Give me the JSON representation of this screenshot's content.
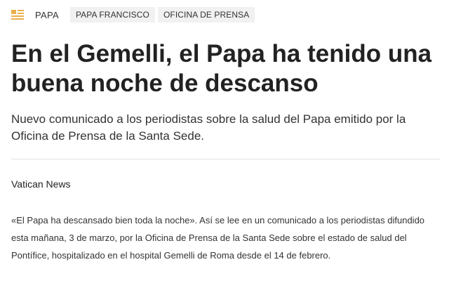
{
  "header": {
    "icon": "news-icon",
    "section": "PAPA",
    "tags": [
      "PAPA FRANCISCO",
      "OFICINA DE PRENSA"
    ]
  },
  "article": {
    "title": "En el Gemelli, el Papa ha tenido una buena noche de descanso",
    "subtitle": "Nuevo comunicado a los periodistas sobre la salud del Papa emitido por la Oficina de Prensa de la Santa Sede.",
    "byline": "Vatican News",
    "body": "«El Papa ha descansado bien toda la noche». Así se lee en un comunicado a los periodistas difundido esta mañana, 3 de marzo, por la Oficina de Prensa de la Santa Sede sobre el estado de salud del Pontífice, hospitalizado en el hospital Gemelli de Roma desde el 14 de febrero."
  },
  "colors": {
    "accent": "#e8b04a",
    "tag_bg": "#f1f1f1",
    "text": "#222222"
  }
}
